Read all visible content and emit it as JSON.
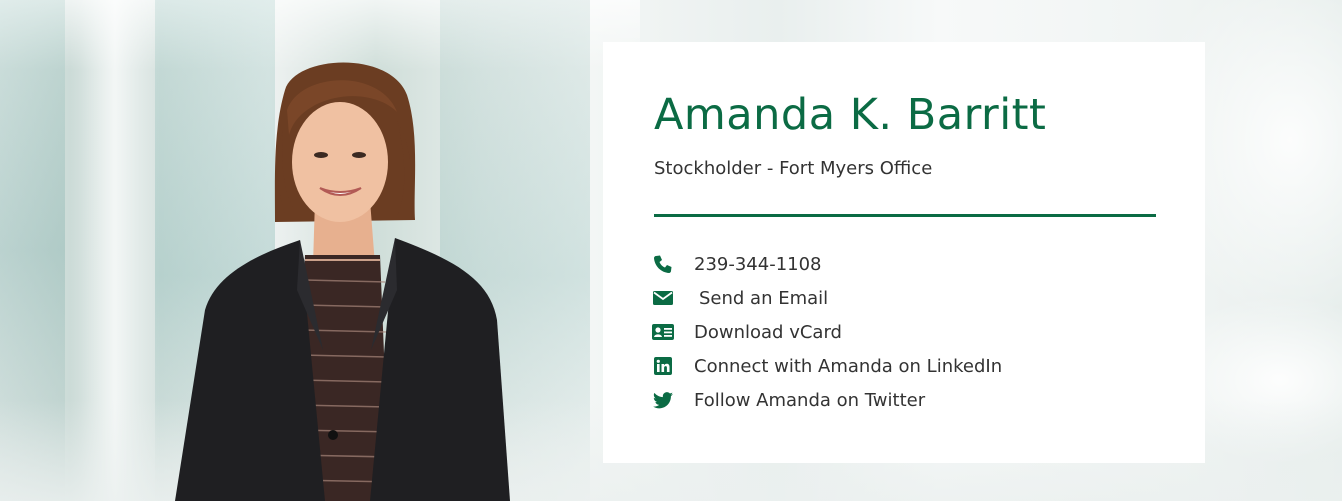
{
  "profile": {
    "name": "Amanda K. Barritt",
    "title": "Stockholder - Fort Myers Office"
  },
  "contacts": [
    {
      "icon": "phone-icon",
      "label": "239-344-1108"
    },
    {
      "icon": "envelope-icon",
      "label": "Send an Email"
    },
    {
      "icon": "vcard-icon",
      "label": "Download vCard"
    },
    {
      "icon": "linkedin-icon",
      "label": "Connect with Amanda on LinkedIn"
    },
    {
      "icon": "twitter-icon",
      "label": "Follow Amanda on Twitter"
    }
  ],
  "colors": {
    "accent": "#0b6b44",
    "text": "#333333",
    "card": "#ffffff"
  }
}
